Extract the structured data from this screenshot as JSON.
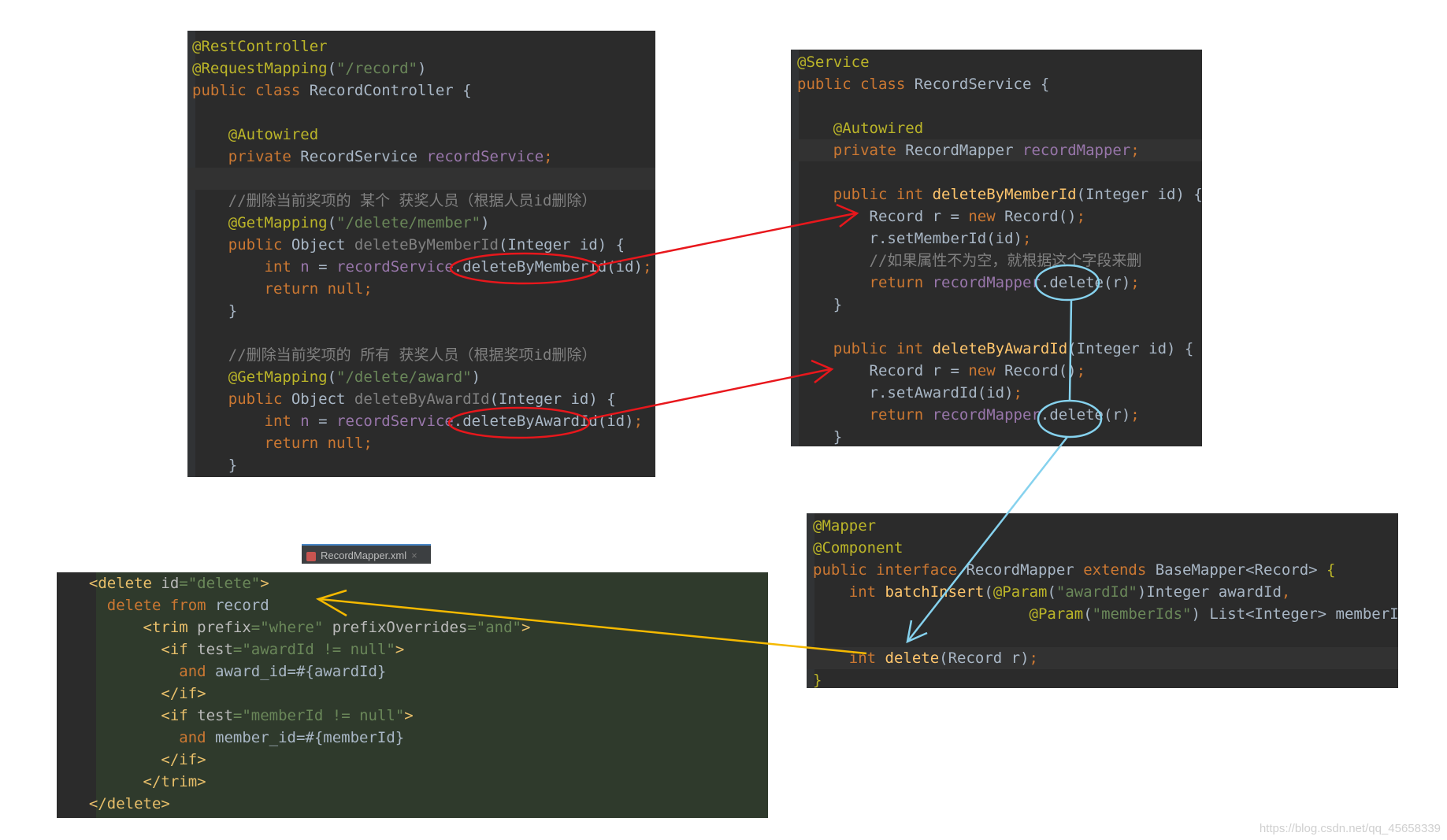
{
  "controller": {
    "lines": [
      [
        [
          "ann",
          "@RestController"
        ]
      ],
      [
        [
          "ann",
          "@RequestMapping"
        ],
        [
          "",
          "("
        ],
        [
          "str",
          "\"/record\""
        ],
        [
          "",
          ")"
        ]
      ],
      [
        [
          "kw",
          "public class "
        ],
        [
          "",
          "RecordController {"
        ]
      ],
      [],
      [
        [
          "ann",
          "    @Autowired"
        ]
      ],
      [
        [
          "kw",
          "    private "
        ],
        [
          "",
          "RecordService "
        ],
        [
          "fld",
          "recordService"
        ],
        [
          "kw",
          ";"
        ]
      ],
      [],
      [
        [
          "cmt",
          "    //删除当前奖项的 某个 获奖人员（根据人员id删除）"
        ]
      ],
      [
        [
          "ann",
          "    @GetMapping"
        ],
        [
          "",
          "("
        ],
        [
          "str",
          "\"/delete/member\""
        ],
        [
          "",
          ")"
        ]
      ],
      [
        [
          "kw",
          "    public "
        ],
        [
          "",
          "Object "
        ],
        [
          "dim",
          "deleteByMemberId"
        ],
        [
          "",
          "(Integer id) {"
        ]
      ],
      [
        [
          "kw",
          "        int "
        ],
        [
          "fld",
          "n"
        ],
        [
          "",
          " = "
        ],
        [
          "fld",
          "recordService"
        ],
        [
          "",
          ".deleteByMemberId(id)"
        ],
        [
          "kw",
          ";"
        ]
      ],
      [
        [
          "kw",
          "        return null;"
        ]
      ],
      [
        [
          "",
          "    }"
        ]
      ],
      [],
      [
        [
          "cmt",
          "    //删除当前奖项的 所有 获奖人员（根据奖项id删除）"
        ]
      ],
      [
        [
          "ann",
          "    @GetMapping"
        ],
        [
          "",
          "("
        ],
        [
          "str",
          "\"/delete/award\""
        ],
        [
          "",
          ")"
        ]
      ],
      [
        [
          "kw",
          "    public "
        ],
        [
          "",
          "Object "
        ],
        [
          "dim",
          "deleteByAwardId"
        ],
        [
          "",
          "(Integer id) {"
        ]
      ],
      [
        [
          "kw",
          "        int "
        ],
        [
          "fld",
          "n"
        ],
        [
          "",
          " = "
        ],
        [
          "fld",
          "recordService"
        ],
        [
          "",
          ".deleteByAwardId(id)"
        ],
        [
          "kw",
          ";"
        ]
      ],
      [
        [
          "kw",
          "        return null;"
        ]
      ],
      [
        [
          "",
          "    }"
        ]
      ]
    ]
  },
  "service": {
    "lines": [
      [
        [
          "ann",
          "@Service"
        ]
      ],
      [
        [
          "kw",
          "public class "
        ],
        [
          "",
          "RecordService {"
        ]
      ],
      [],
      [
        [
          "ann",
          "    @Autowired"
        ]
      ],
      [
        [
          "kw",
          "    private "
        ],
        [
          "",
          "RecordMapper "
        ],
        [
          "fld",
          "recordMapper"
        ],
        [
          "kw",
          ";"
        ]
      ],
      [],
      [
        [
          "kw",
          "    public int "
        ],
        [
          "fn",
          "deleteByMemberId"
        ],
        [
          "",
          "(Integer id) {"
        ]
      ],
      [
        [
          "",
          "        Record r = "
        ],
        [
          "kw",
          "new "
        ],
        [
          "",
          "Record()"
        ],
        [
          "kw",
          ";"
        ]
      ],
      [
        [
          "",
          "        r.setMemberId(id)"
        ],
        [
          "kw",
          ";"
        ]
      ],
      [
        [
          "cmt",
          "        //如果属性不为空，就根据这个字段来删"
        ]
      ],
      [
        [
          "kw",
          "        return "
        ],
        [
          "fld",
          "recordMapper"
        ],
        [
          "",
          ".delete(r)"
        ],
        [
          "kw",
          ";"
        ]
      ],
      [
        [
          "",
          "    }"
        ]
      ],
      [],
      [
        [
          "kw",
          "    public int "
        ],
        [
          "fn",
          "deleteByAwardId"
        ],
        [
          "",
          "(Integer id) {"
        ]
      ],
      [
        [
          "",
          "        Record r = "
        ],
        [
          "kw",
          "new "
        ],
        [
          "",
          "Record()"
        ],
        [
          "kw",
          ";"
        ]
      ],
      [
        [
          "",
          "        r.setAwardId(id)"
        ],
        [
          "kw",
          ";"
        ]
      ],
      [
        [
          "kw",
          "        return "
        ],
        [
          "fld",
          "recordMapper"
        ],
        [
          "",
          ".delete(r)"
        ],
        [
          "kw",
          ";"
        ]
      ],
      [
        [
          "",
          "    }"
        ]
      ]
    ]
  },
  "mapper": {
    "lines": [
      [
        [
          "ann",
          "@Mapper"
        ]
      ],
      [
        [
          "ann",
          "@Component"
        ]
      ],
      [
        [
          "kw",
          "public interface "
        ],
        [
          "",
          "RecordMapper "
        ],
        [
          "kw",
          "extends "
        ],
        [
          "",
          "BaseMapper<Record> "
        ],
        [
          "ann",
          "{"
        ]
      ],
      [
        [
          "kw",
          "    int "
        ],
        [
          "fn",
          "batchInsert"
        ],
        [
          "",
          "("
        ],
        [
          "ann",
          "@Param"
        ],
        [
          "",
          "("
        ],
        [
          "str",
          "\"awardId\""
        ],
        [
          "",
          ")Integer awardId"
        ],
        [
          "kw",
          ","
        ]
      ],
      [
        [
          "",
          "                        "
        ],
        [
          "ann",
          "@Param"
        ],
        [
          "",
          "("
        ],
        [
          "str",
          "\"memberIds\""
        ],
        [
          "",
          ") List<Integer> memberIds)"
        ],
        [
          "kw",
          ";"
        ]
      ],
      [],
      [
        [
          "kw",
          "    int "
        ],
        [
          "fn",
          "delete"
        ],
        [
          "",
          "(Record r)"
        ],
        [
          "kw",
          ";"
        ]
      ],
      [
        [
          "ann",
          "}"
        ]
      ]
    ]
  },
  "xml": {
    "tab_label": "RecordMapper.xml",
    "lines": [
      [
        [
          "tag",
          "  <delete "
        ],
        [
          "attr",
          "id"
        ],
        [
          "str",
          "=\"delete\""
        ],
        [
          "tag",
          ">"
        ]
      ],
      [
        [
          "kw",
          "    delete from "
        ],
        [
          "",
          "record"
        ]
      ],
      [
        [
          "tag",
          "        <trim "
        ],
        [
          "attr",
          "prefix"
        ],
        [
          "str",
          "=\"where\" "
        ],
        [
          "attr",
          "prefixOverrides"
        ],
        [
          "str",
          "=\"and\""
        ],
        [
          "tag",
          ">"
        ]
      ],
      [
        [
          "tag",
          "          <if "
        ],
        [
          "attr",
          "test"
        ],
        [
          "str",
          "=\"awardId != null\""
        ],
        [
          "tag",
          ">"
        ]
      ],
      [
        [
          "kw",
          "            and "
        ],
        [
          "",
          "award_id=#{awardId}"
        ]
      ],
      [
        [
          "tag",
          "          </if>"
        ]
      ],
      [
        [
          "tag",
          "          <if "
        ],
        [
          "attr",
          "test"
        ],
        [
          "str",
          "=\"memberId != null\""
        ],
        [
          "tag",
          ">"
        ]
      ],
      [
        [
          "kw",
          "            and "
        ],
        [
          "",
          "member_id=#{memberId}"
        ]
      ],
      [
        [
          "tag",
          "          </if>"
        ]
      ],
      [
        [
          "tag",
          "        </trim>"
        ]
      ],
      [
        [
          "tag",
          "  </delete>"
        ]
      ]
    ]
  },
  "watermark": "https://blog.csdn.net/qq_45658339",
  "colors": {
    "red_arrow": "#e8171c",
    "blue_arrow": "#86d2ee",
    "yellow_arrow": "#f5b900"
  }
}
